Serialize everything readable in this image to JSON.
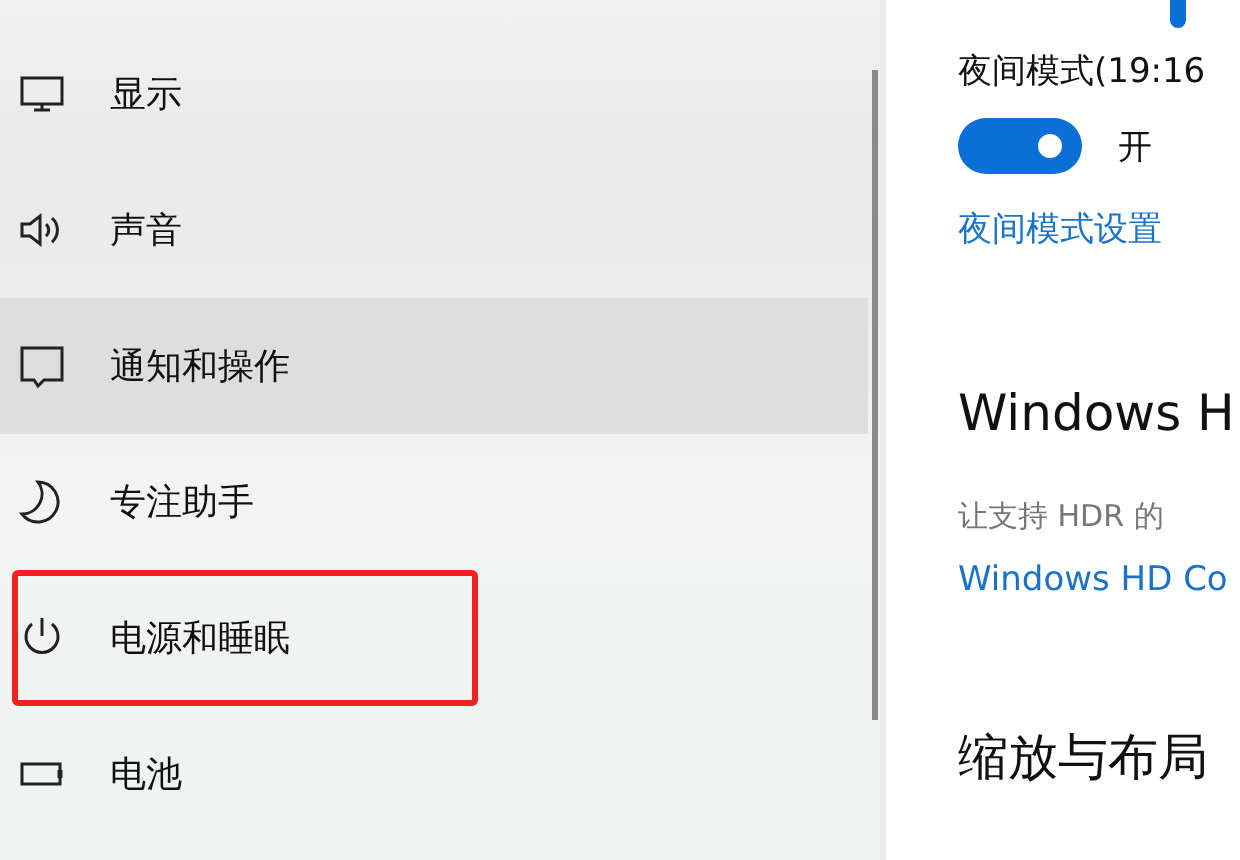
{
  "sidebar": {
    "items": [
      {
        "label": "显示",
        "kind": "display",
        "hovered": false,
        "highlighted": false
      },
      {
        "label": "声音",
        "kind": "sound",
        "hovered": false,
        "highlighted": false
      },
      {
        "label": "通知和操作",
        "kind": "notification",
        "hovered": true,
        "highlighted": false
      },
      {
        "label": "专注助手",
        "kind": "focus",
        "hovered": false,
        "highlighted": false
      },
      {
        "label": "电源和睡眠",
        "kind": "power",
        "hovered": false,
        "highlighted": true
      },
      {
        "label": "电池",
        "kind": "battery",
        "hovered": false,
        "highlighted": false
      }
    ]
  },
  "content": {
    "night_mode_label": "夜间模式(19:16",
    "night_mode_toggle": {
      "on": true,
      "state_label": "开"
    },
    "night_mode_link": "夜间模式设置",
    "hdr_heading": "Windows H",
    "hdr_description": "让支持 HDR 的",
    "hdr_link": "Windows HD Co",
    "scale_heading": "缩放与布局"
  }
}
